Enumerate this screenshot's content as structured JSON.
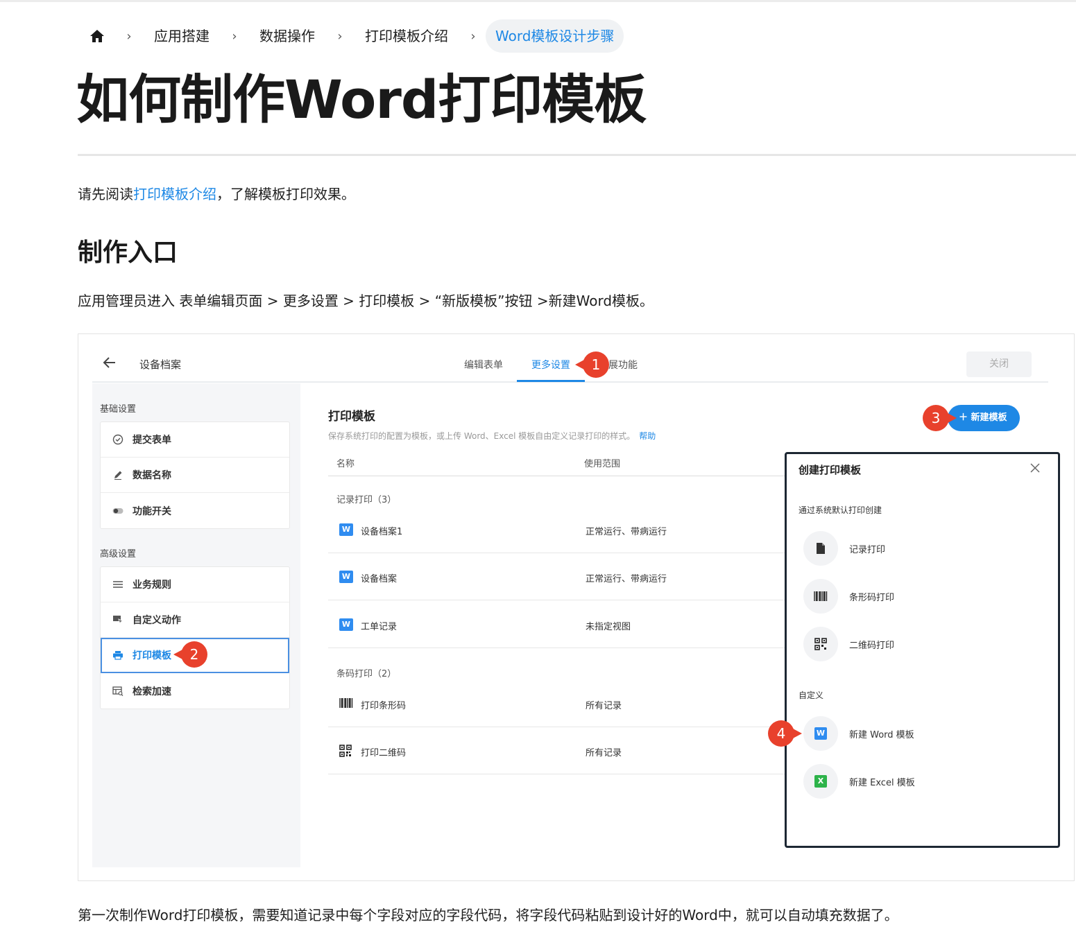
{
  "breadcrumb": {
    "home_icon": "home-icon",
    "items": [
      "应用搭建",
      "数据操作",
      "打印模板介绍"
    ],
    "current": "Word模板设计步骤"
  },
  "title": "如何制作Word打印模板",
  "intro": {
    "before": "请先阅读",
    "link": "打印模板介绍",
    "after": "，了解模板打印效果。"
  },
  "section": {
    "heading": "制作入口",
    "path_text": "应用管理员进入 表单编辑页面 > 更多设置 > 打印模板 > “新版模板”按钮 >新建Word模板。"
  },
  "screenshot": {
    "app_name": "设备档案",
    "tabs": [
      "编辑表单",
      "更多设置",
      "展功能"
    ],
    "active_tab": "更多设置",
    "close_label": "关闭",
    "sidebar": {
      "basic_label": "基础设置",
      "basic_items": [
        "提交表单",
        "数据名称",
        "功能开关"
      ],
      "advanced_label": "高级设置",
      "advanced_items": [
        "业务规则",
        "自定义动作",
        "打印模板",
        "检索加速"
      ]
    },
    "main": {
      "title": "打印模板",
      "desc": "保存系统打印的配置为模板，或上传 Word、Excel 模板自由定义记录打印的样式。",
      "help": "帮助",
      "new_button": "新建模板",
      "col_name": "名称",
      "col_scope": "使用范围",
      "group1": "记录打印（3）",
      "group2": "条码打印（2）",
      "rows1": [
        {
          "name": "设备档案1",
          "scope": "正常运行、带病运行"
        },
        {
          "name": "设备档案",
          "scope": "正常运行、带病运行"
        },
        {
          "name": "工单记录",
          "scope": "未指定视图"
        }
      ],
      "rows2": [
        {
          "name": "打印条形码",
          "scope": "所有记录"
        },
        {
          "name": "打印二维码",
          "scope": "所有记录"
        }
      ],
      "word_badge": "W"
    },
    "dialog": {
      "title": "创建打印模板",
      "system_label": "通过系统默认打印创建",
      "system_options": [
        "记录打印",
        "条形码打印",
        "二维码打印"
      ],
      "custom_label": "自定义",
      "custom_options": [
        "新建 Word 模板",
        "新建 Excel 模板"
      ],
      "word_badge": "W",
      "excel_badge": "X"
    },
    "markers": [
      "1",
      "2",
      "3",
      "4"
    ],
    "colors": {
      "accent": "#1e88e5",
      "marker": "#e8412c"
    }
  },
  "closing": "第一次制作Word打印模板，需要知道记录中每个字段对应的字段代码，将字段代码粘贴到设计好的Word中，就可以自动填充数据了。"
}
